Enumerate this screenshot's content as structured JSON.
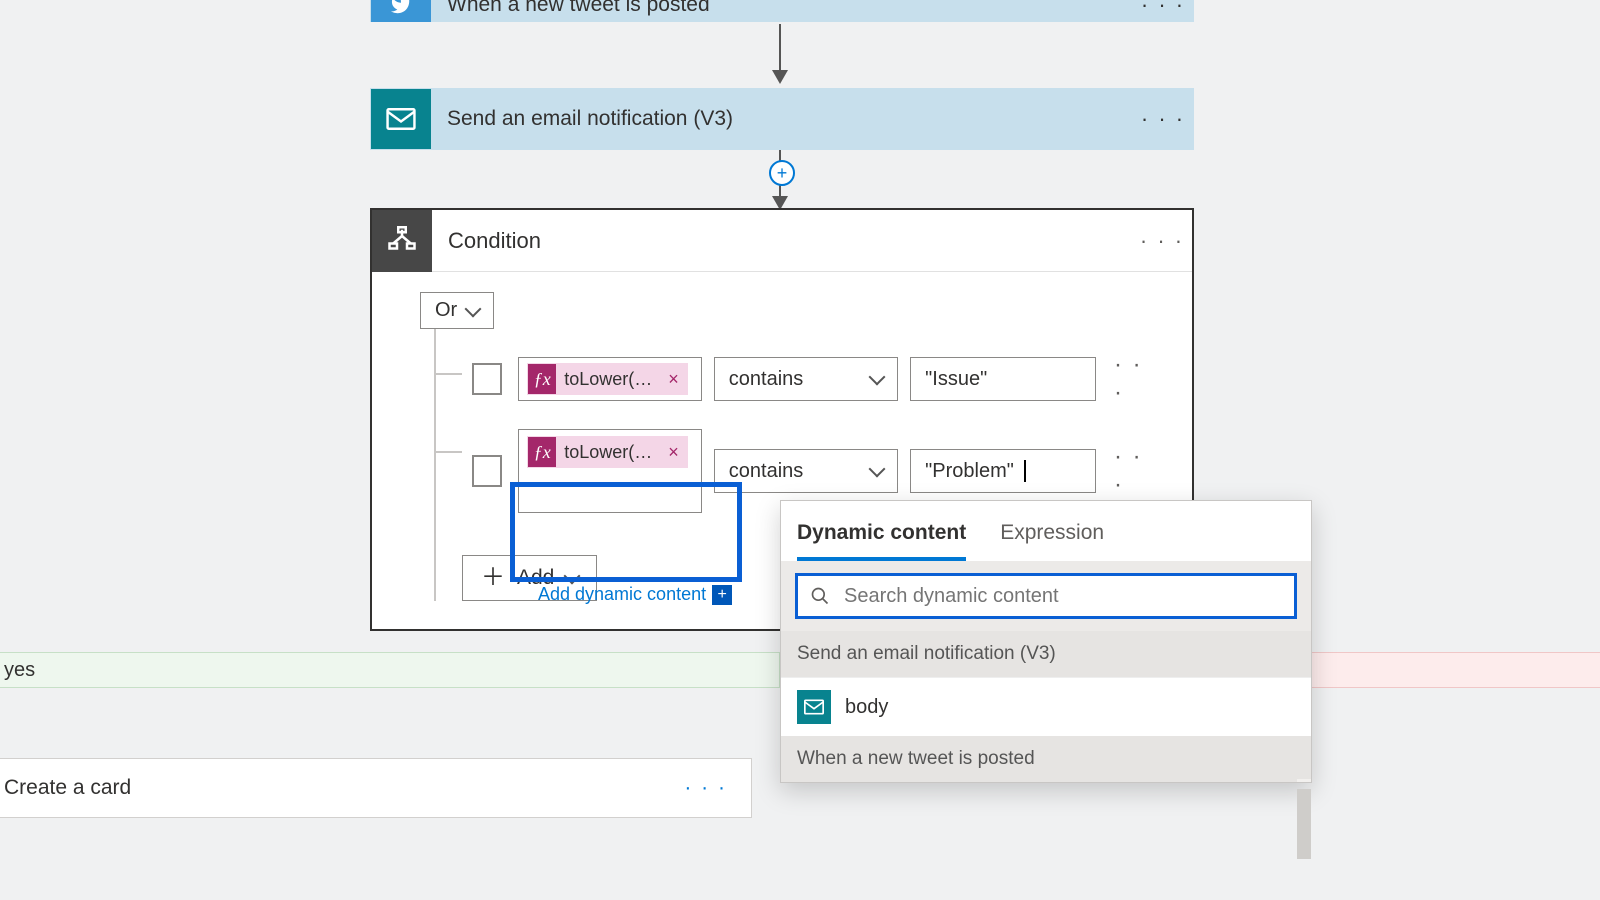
{
  "steps": {
    "twitter_label": "When a new tweet is posted",
    "email_label": "Send an email notification (V3)"
  },
  "condition": {
    "title": "Condition",
    "group_op": "Or",
    "rows": [
      {
        "expr": "toLower(…",
        "operator": "contains",
        "value": "\"Issue\""
      },
      {
        "expr": "toLower(…",
        "operator": "contains",
        "value": "\"Problem\""
      }
    ],
    "add_label": "Add",
    "add_dynamic_label": "Add dynamic content"
  },
  "branches": {
    "yes_label": "yes",
    "create_card_label": "Create a card"
  },
  "flyout": {
    "tab_dynamic": "Dynamic content",
    "tab_expression": "Expression",
    "search_placeholder": "Search dynamic content",
    "group1": "Send an email notification (V3)",
    "item1": "body",
    "group2": "When a new tweet is posted"
  },
  "colors": {
    "accent": "#0078d4",
    "fx": "#a4276a",
    "email": "#08838f",
    "twitter": "#3a96d6"
  }
}
